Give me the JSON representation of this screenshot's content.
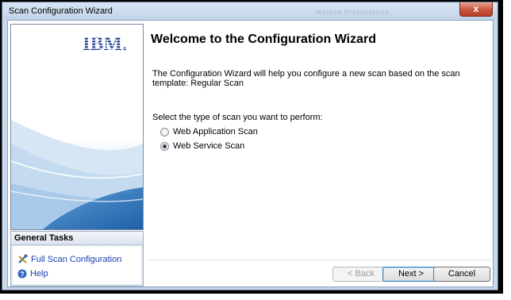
{
  "window": {
    "title": "Scan Configuration Wizard",
    "ghost_title": "Method   Presentation",
    "close_label": "x"
  },
  "brand": {
    "logo_text": "IBM."
  },
  "sidebar": {
    "tasks_header": "General Tasks",
    "tasks": [
      {
        "label": "Full Scan Configuration",
        "icon": "tools-icon"
      },
      {
        "label": "Help",
        "icon": "help-icon"
      }
    ]
  },
  "main": {
    "heading": "Welcome to the Configuration Wizard",
    "description": "The Configuration Wizard will help you configure a new scan based on the scan template: Regular Scan",
    "prompt": "Select the type of scan you want to perform:",
    "options": [
      {
        "label": "Web Application Scan",
        "selected": false
      },
      {
        "label": "Web Service Scan",
        "selected": true
      }
    ]
  },
  "buttons": {
    "back": "< Back",
    "next": "Next >",
    "cancel": "Cancel"
  },
  "colors": {
    "link": "#1a3eb0",
    "ibm_blue": "#1f3f91",
    "titlebar": "#c9d8ea"
  }
}
